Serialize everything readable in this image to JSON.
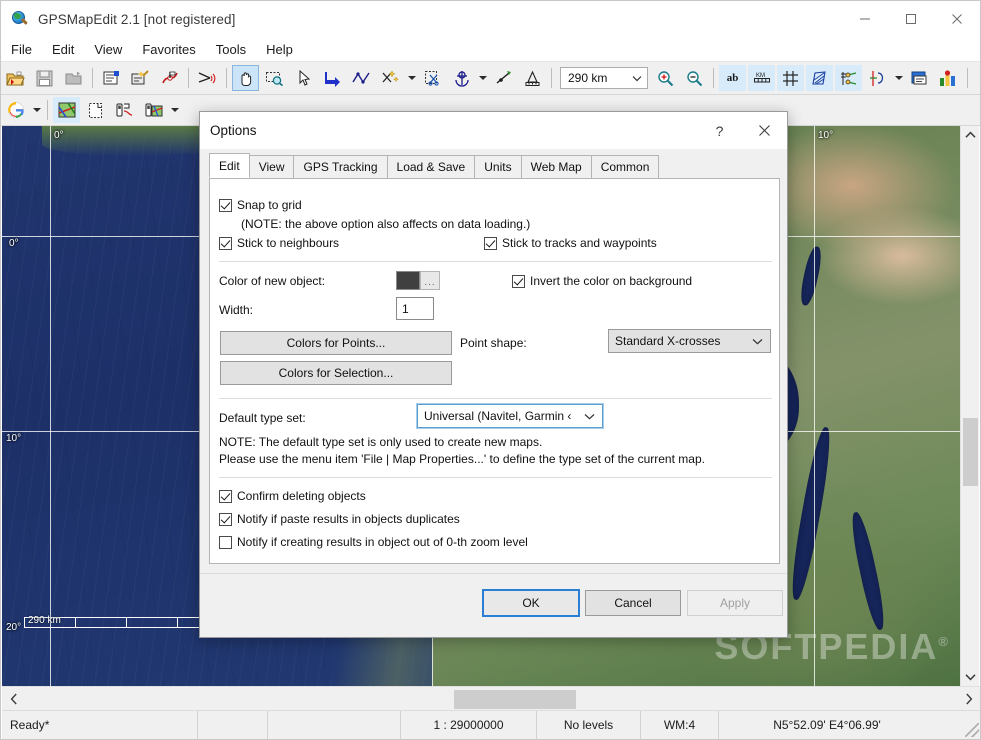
{
  "window": {
    "title": "GPSMapEdit 2.1 [not registered]",
    "icon": "globe-magnifier-icon",
    "controls": {
      "minimize": "minimize-icon",
      "maximize": "maximize-icon",
      "close": "close-icon"
    }
  },
  "menubar": {
    "items": [
      "File",
      "Edit",
      "View",
      "Favorites",
      "Tools",
      "Help"
    ]
  },
  "toolbar1": {
    "zoom_value": "290 km",
    "icons": [
      "open-file-icon",
      "save-icon",
      "close-map-icon",
      "map-properties-icon",
      "map-wizard-icon",
      "route-edit-icon",
      "cut-tool-icon",
      "pan-tool-icon",
      "zoom-select-icon",
      "select-tool-icon",
      "create-polygon-icon",
      "create-polyline-icon",
      "create-point-icon",
      "split-object-icon",
      "anchor-tool-icon",
      "insert-node-icon",
      "measure-tool-icon",
      "zoom-in-icon",
      "zoom-out-icon",
      "labels-toggle-icon",
      "scale-bar-toggle-icon",
      "grid-toggle-icon",
      "hatch-toggle-icon",
      "nodes-toggle-icon",
      "levels-icon",
      "legend-icon",
      "statistics-icon"
    ]
  },
  "toolbar2": {
    "icons": [
      "google-maps-icon",
      "map-layer-icon",
      "new-map-icon",
      "gps-download-icon",
      "gps-upload-icon"
    ]
  },
  "map": {
    "grid_labels_left": [
      "0°",
      "10°",
      "20°"
    ],
    "grid_labels_top": [
      "0°",
      "10°"
    ],
    "scale_label": "290 km",
    "watermark": "SOFTPEDIA"
  },
  "scrollbars": {
    "vertical": {
      "up": "chevron-up-icon",
      "down": "chevron-down-icon"
    },
    "horizontal": {
      "left": "chevron-left-icon",
      "right": "chevron-right-icon"
    }
  },
  "statusbar": {
    "ready": "Ready*",
    "scale": "1 : 29000000",
    "levels": "No levels",
    "wm": "WM:4",
    "coords": "N5°52.09' E4°06.99'"
  },
  "dialog": {
    "title": "Options",
    "help_btn": "?",
    "close_btn": "close-icon",
    "tabs": [
      {
        "label": "Edit",
        "active": true
      },
      {
        "label": "View",
        "active": false
      },
      {
        "label": "GPS Tracking",
        "active": false
      },
      {
        "label": "Load & Save",
        "active": false
      },
      {
        "label": "Units",
        "active": false
      },
      {
        "label": "Web Map",
        "active": false
      },
      {
        "label": "Common",
        "active": false
      }
    ],
    "edit_tab": {
      "snap_to_grid": {
        "label": "Snap to grid",
        "checked": true
      },
      "snap_note": "(NOTE: the above option also affects on data loading.)",
      "stick_neighbours": {
        "label": "Stick to neighbours",
        "checked": true
      },
      "stick_tracks": {
        "label": "Stick to tracks and waypoints",
        "checked": true
      },
      "color_label": "Color of new object:",
      "color_value": "#404040",
      "color_browse": "...",
      "invert_color": {
        "label": "Invert the color on background",
        "checked": true
      },
      "width_label": "Width:",
      "width_value": "1",
      "colors_points_btn": "Colors for Points...",
      "colors_selection_btn": "Colors for Selection...",
      "point_shape_label": "Point shape:",
      "point_shape_value": "Standard X-crosses",
      "default_type_set_label": "Default type set:",
      "default_type_set_value": "Universal (Navitel, Garmin ‹",
      "note_line1": "NOTE: The default type set is only used to create new maps.",
      "note_line2": "Please use the menu item 'File | Map Properties...' to define the type set of the current map.",
      "confirm_deleting": {
        "label": "Confirm deleting objects",
        "checked": true
      },
      "notify_paste": {
        "label": "Notify if paste results in objects duplicates",
        "checked": true
      },
      "notify_creating": {
        "label": "Notify if creating results in object out of 0-th zoom level",
        "checked": false
      }
    },
    "footer": {
      "ok": "OK",
      "cancel": "Cancel",
      "apply": "Apply",
      "apply_disabled": true
    }
  },
  "colors": {
    "accent": "#2a7fd4",
    "toolbar_bg": "#f0f0f0",
    "selection": "#cce4f7"
  }
}
